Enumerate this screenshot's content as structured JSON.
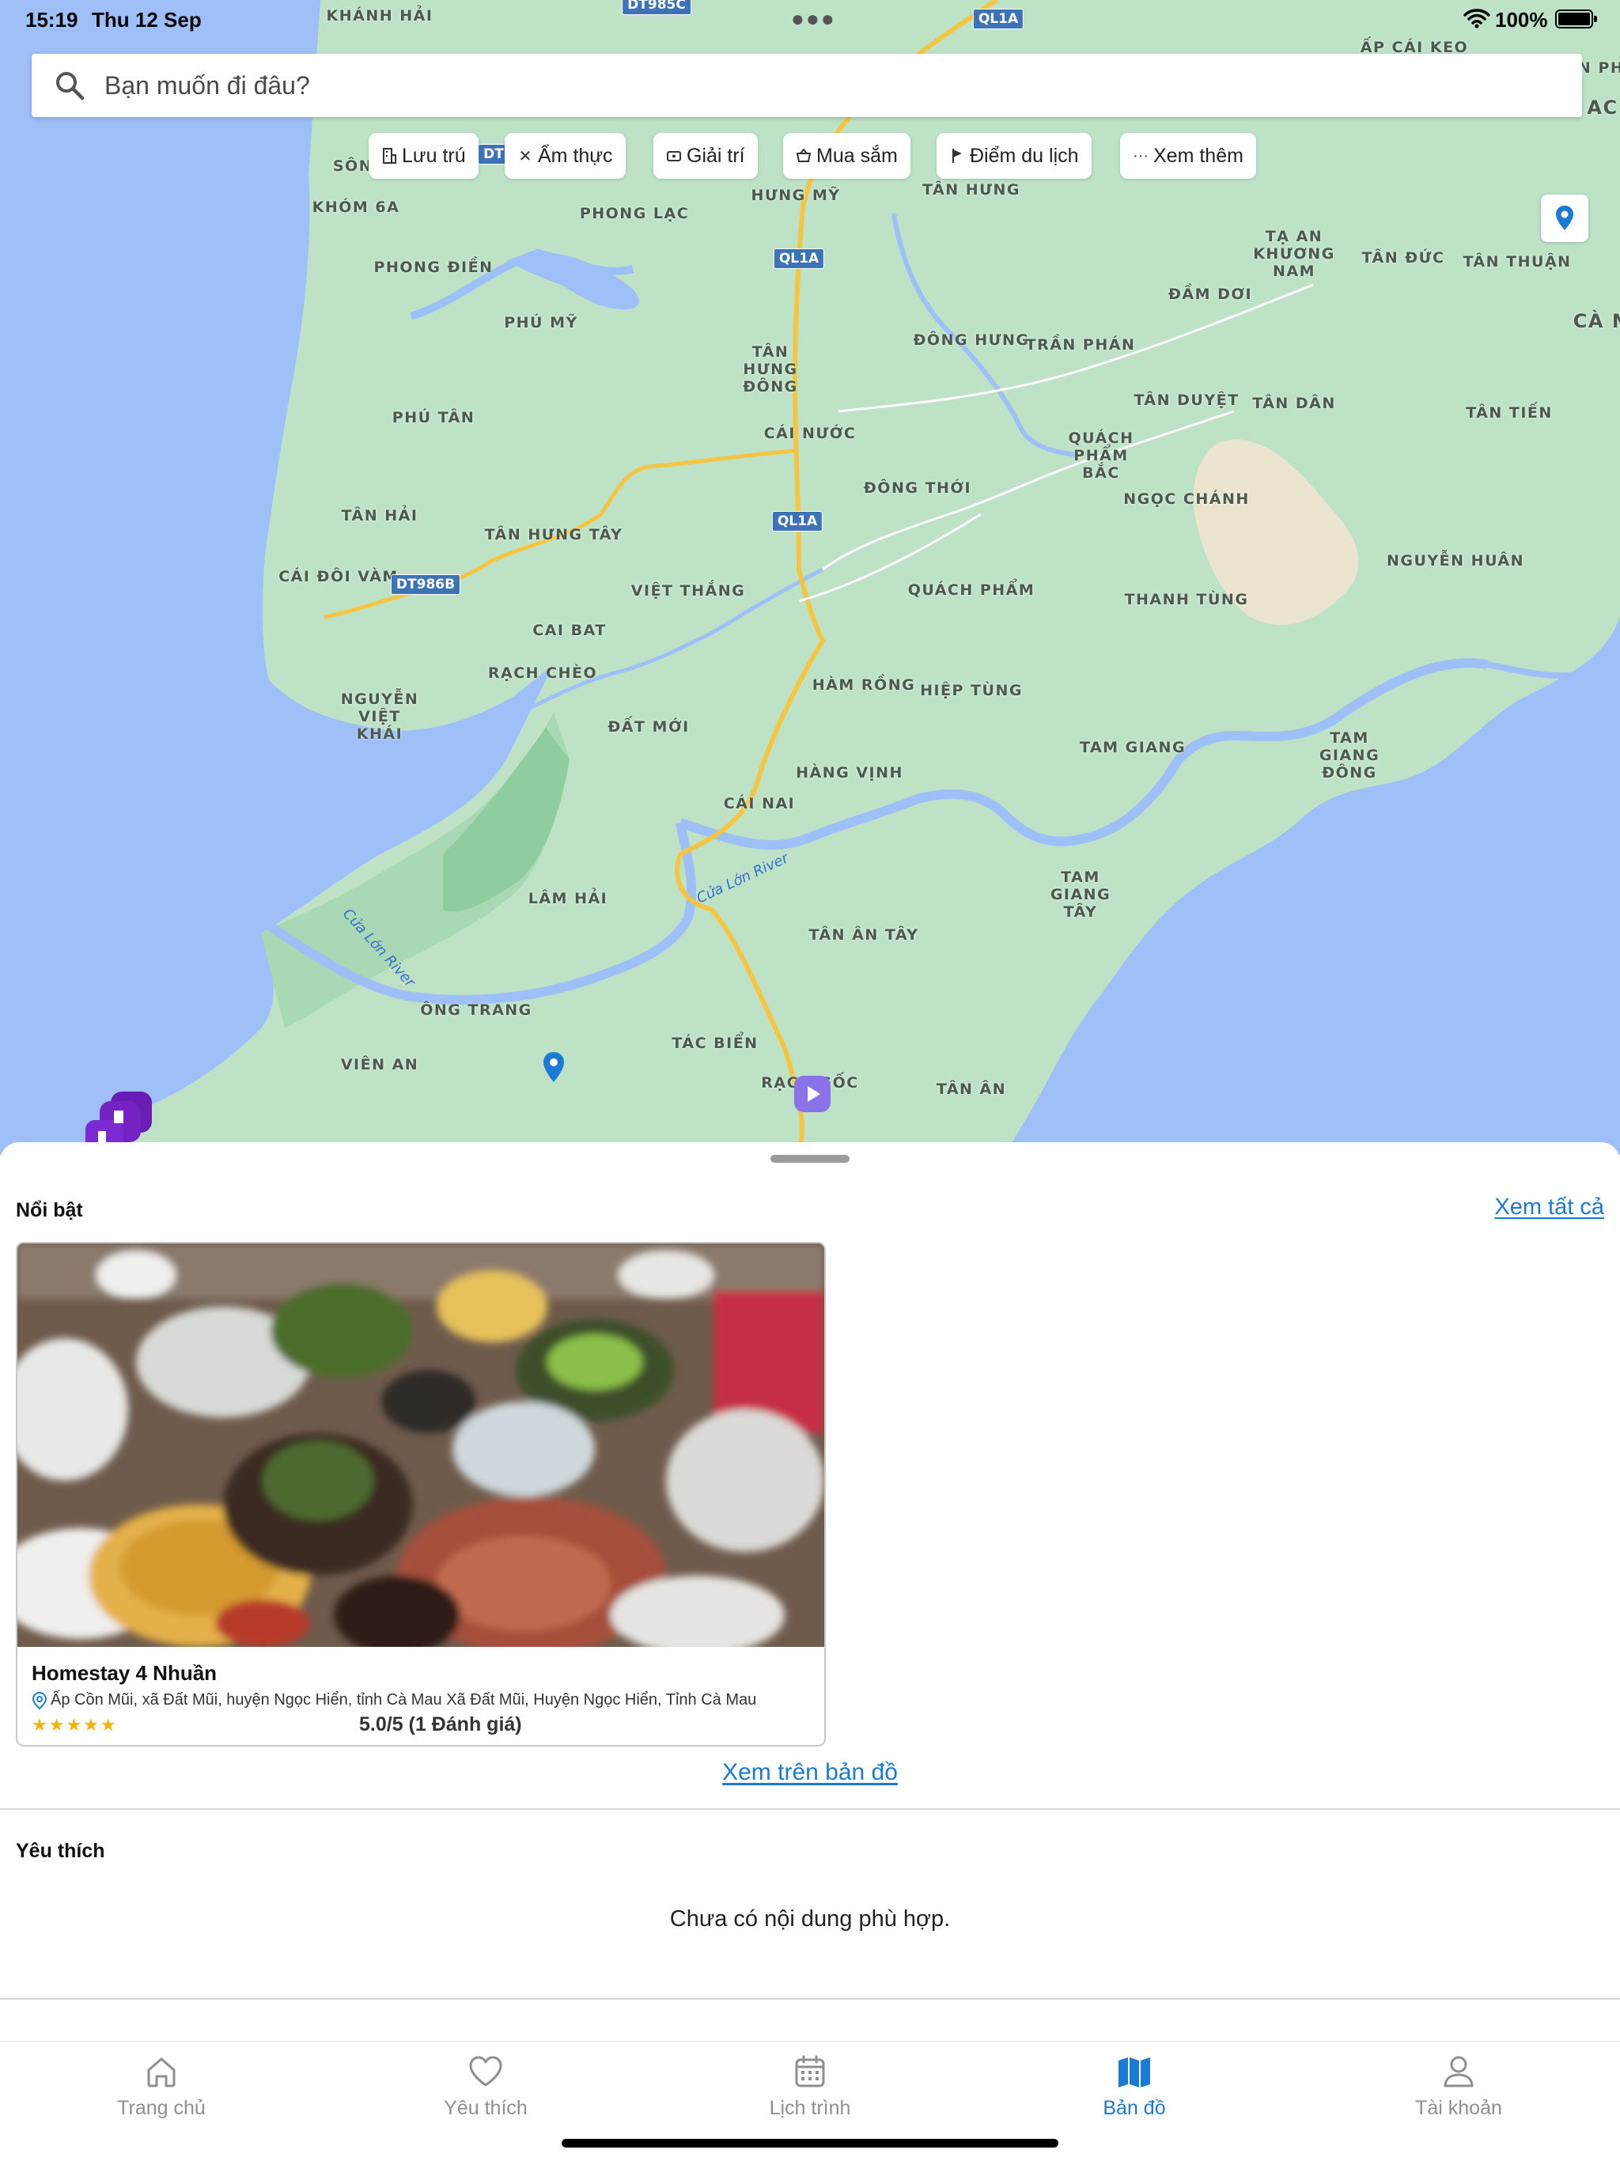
{
  "status_bar": {
    "time": "15:19",
    "date": "Thu 12 Sep",
    "battery": "100%"
  },
  "search": {
    "placeholder": "Bạn muốn đi đâu?"
  },
  "categories": [
    {
      "label": "Lưu trú",
      "icon": "hotel-icon"
    },
    {
      "label": "Ẩm thực",
      "icon": "utensils-icon"
    },
    {
      "label": "Giải trí",
      "icon": "ticket-icon"
    },
    {
      "label": "Mua sắm",
      "icon": "basket-icon"
    },
    {
      "label": "Điểm du lịch",
      "icon": "flag-icon"
    },
    {
      "label": "Xem thêm",
      "icon": "ellipsis-icon"
    }
  ],
  "map": {
    "places": [
      "KHÁNH HẢI",
      "SÔN",
      "KHÓM 6A",
      "PHONG LẠC",
      "HƯNG MỸ",
      "TÂN HƯNG",
      "PHONG ĐIỀN",
      "PHÚ MỸ",
      "TÂN HƯNG ĐÔNG",
      "ĐÔNG HƯNG",
      "TRẦN PHÁN",
      "TẠ AN KHƯƠNG NAM",
      "TÂN ĐỨC",
      "TÂN THUẬN",
      "ĐẦM DƠI",
      "PHÚ TÂN",
      "CÁI NƯỚC",
      "TÂN DUYỆT",
      "TÂN DÂN",
      "TÂN TIẾN",
      "QUÁCH PHẨM BẮC",
      "ĐÔNG THỚI",
      "NGỌC CHÁNH",
      "TÂN HẢI",
      "TÂN HƯNG TÂY",
      "CÁI ĐÔI VÀM",
      "VIỆT THẮNG",
      "QUÁCH PHẨM",
      "THANH TÙNG",
      "NGUYỄN HUÂN",
      "CAI BAT",
      "RẠCH CHÈO",
      "HÀM RỒNG",
      "HIỆP TÙNG",
      "NGUYỄN VIỆT KHÁI",
      "ĐẤT MỚI",
      "TAM GIANG",
      "TAM GIANG ĐÔNG",
      "HÀNG VỊNH",
      "CÁI NAI",
      "LÂM HẢI",
      "TAM GIANG TÂY",
      "TÂN ÂN TÂY",
      "ÔNG TRANG",
      "VIÊN AN",
      "TÁC BIỂN",
      "RẠCH GỐC",
      "TÂN ÂN",
      "ẤP CÁI KEO",
      "CÀ M",
      "AC",
      "AN PH"
    ],
    "shields": [
      "DT985C",
      "QL1A",
      "QL1A",
      "QL1A",
      "DT986B",
      "DT"
    ],
    "rivers": [
      "Cửa Lớn River",
      "Cửa Lớn River"
    ]
  },
  "featured": {
    "title": "Nổi bật",
    "see_all": "Xem tất cả",
    "card": {
      "name": "Homestay 4 Nhuần",
      "address": "Ấp Cồn Mũi, xã Đất Mũi, huyện Ngọc Hiển, tỉnh Cà Mau  Xã Đất Mũi, Huyện Ngọc Hiển, Tỉnh Cà Mau",
      "stars": "★★★★★",
      "rating_text": "5.0/5 (1 Đánh giá)",
      "rating": 5.0
    },
    "view_on_map": "Xem trên bản đồ"
  },
  "favorites": {
    "title": "Yêu thích",
    "empty_text": "Chưa có nội dung phù hợp."
  },
  "tabs": [
    {
      "label": "Trang chủ",
      "icon": "home-icon",
      "active": false
    },
    {
      "label": "Yêu thích",
      "icon": "heart-icon",
      "active": false
    },
    {
      "label": "Lịch trình",
      "icon": "calendar-icon",
      "active": false
    },
    {
      "label": "Bản đồ",
      "icon": "map-icon",
      "active": true
    },
    {
      "label": "Tài khoản",
      "icon": "person-icon",
      "active": false
    }
  ],
  "colors": {
    "accent": "#1a7bd6",
    "map_land": "#bde2c6",
    "map_water": "#9ebff7",
    "star": "#f2b400"
  }
}
